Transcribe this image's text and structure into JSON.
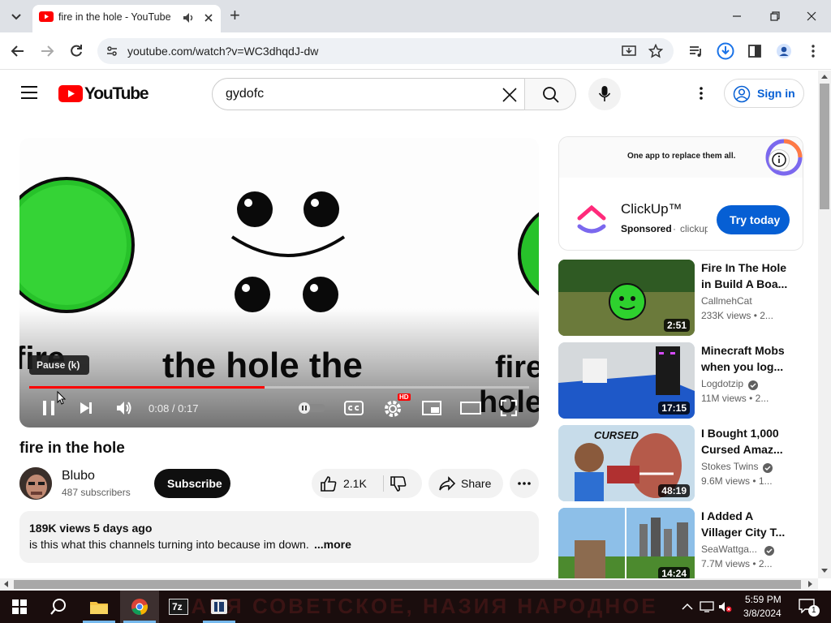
{
  "browser": {
    "tab_title": "fire in the hole - YouTube",
    "url": "youtube.com/watch?v=WC3dhqdJ-dw",
    "new_tab": "+"
  },
  "youtube": {
    "logo_text": "YouTube",
    "search_value": "gydofc",
    "sign_in": "Sign in"
  },
  "ad": {
    "banner_text": "One app to replace them all.",
    "brand": "ClickUp™",
    "sponsored": "Sponsored",
    "domain": "clickup",
    "cta": "Try today"
  },
  "player": {
    "caption_left": "fire",
    "caption_main": "the hole the",
    "caption_right": "fire",
    "caption_right2": "hole",
    "tooltip": "Pause (k)",
    "time": "0:08 / 0:17",
    "progress": 0.47,
    "hd_badge": "HD"
  },
  "video": {
    "title": "fire in the hole",
    "channel": "Blubo",
    "subscribers": "487 subscribers",
    "subscribe": "Subscribe",
    "likes": "2.1K",
    "share": "Share",
    "views": "189K views",
    "age": "5 days ago",
    "description": "is this what this channels turning into because im down.",
    "more": "...more"
  },
  "sidebar": [
    {
      "title": "Fire In The Hole in Build A Boa...",
      "channel": "CallmehCat",
      "meta": "233K views  • 2...",
      "duration": "2:51",
      "verified": false
    },
    {
      "title": "Minecraft Mobs when you log...",
      "channel": "Logdotzip",
      "meta": "11M views  • 2...",
      "duration": "17:15",
      "verified": true
    },
    {
      "title": "I Bought 1,000 Cursed Amaz...",
      "channel": "Stokes Twins",
      "meta": "9.6M views  • 1...",
      "duration": "48:19",
      "verified": true,
      "thumb_label": "CURSED"
    },
    {
      "title": "I Added A Villager City T...",
      "channel": "SeaWattga...",
      "meta": "7.7M views  • 2...",
      "duration": "14:24",
      "verified": true
    }
  ],
  "taskbar": {
    "time": "5:59 PM",
    "date": "3/8/2024",
    "notif_count": "1",
    "wallpaper_text": "ВАНЯ СОВЕТСКОЕ, НАЗИЯ НАРОДНОЕ",
    "app_7z": "7z"
  }
}
